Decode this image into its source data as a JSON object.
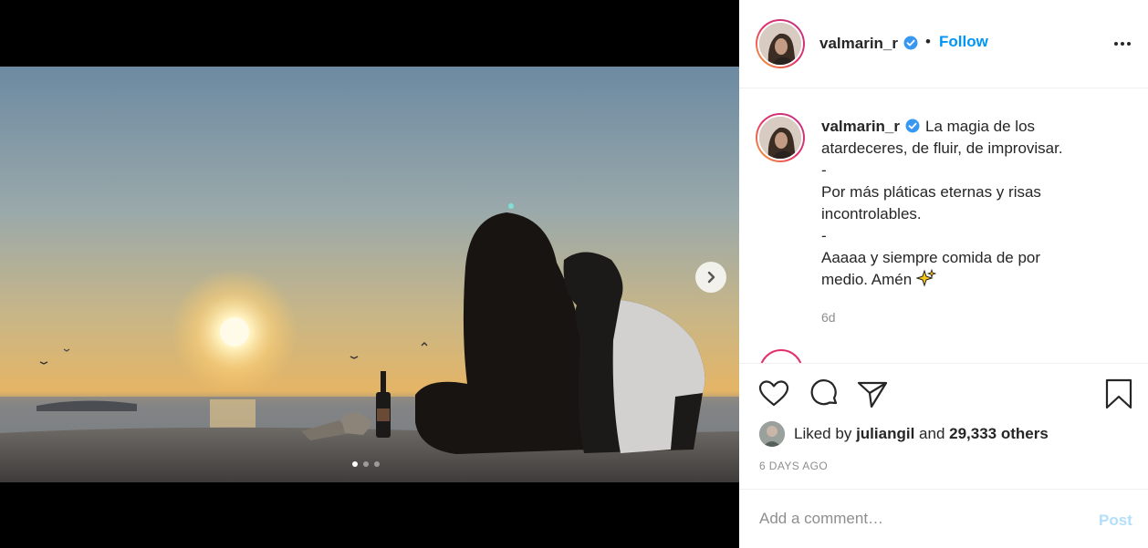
{
  "post": {
    "username": "valmarin_r",
    "verified": true,
    "follow_label": "Follow",
    "bullet": "•",
    "caption_lines": [
      "La magia de los",
      "atardeceres, de fluir, de improvisar.",
      "-",
      "Por más pláticas eternas y risas",
      "incontrolables.",
      "-",
      "Aaaaa y siempre comida de por",
      "medio. Amén"
    ],
    "caption_time": "6d",
    "likes_prefix": "Liked by",
    "liked_by_user": "juliangil",
    "likes_and": "and",
    "likes_others": "29,333 others",
    "date": "6 DAYS AGO",
    "comment_placeholder": "Add a comment…",
    "post_label": "Post"
  },
  "carousel": {
    "slide_count": 3,
    "active_slide": 1
  },
  "colors": {
    "accent": "#0095f6",
    "text": "#262626",
    "muted": "#8e8e8e",
    "post_disabled": "#b2dffc"
  },
  "icons": [
    "verified-badge-icon",
    "more-options-icon",
    "heart-icon",
    "comment-icon",
    "share-icon",
    "bookmark-icon",
    "chevron-right-icon",
    "sparkles-emoji-icon"
  ]
}
